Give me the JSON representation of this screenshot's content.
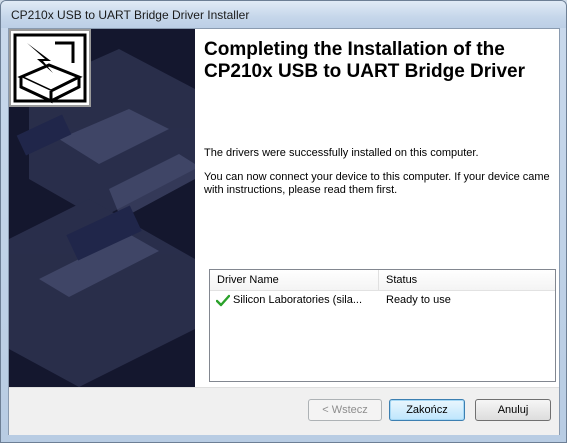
{
  "window": {
    "title": "CP210x USB to UART Bridge Driver Installer"
  },
  "header": {
    "title": "Completing the Installation of the CP210x USB to UART Bridge Driver"
  },
  "body": {
    "message1": "The drivers were successfully installed on this computer.",
    "message2": "You can now connect your device to this computer. If your device came with instructions, please read them first."
  },
  "driver_table": {
    "columns": [
      "Driver Name",
      "Status"
    ],
    "rows": [
      {
        "name": "Silicon Laboratories (sila...",
        "status": "Ready to use",
        "icon": "green-check-icon"
      }
    ]
  },
  "buttons": {
    "back": "< Wstecz",
    "finish": "Zakończ",
    "cancel": "Anuluj"
  },
  "colors": {
    "sidebar": "#14172e",
    "check": "#2aa12a"
  }
}
